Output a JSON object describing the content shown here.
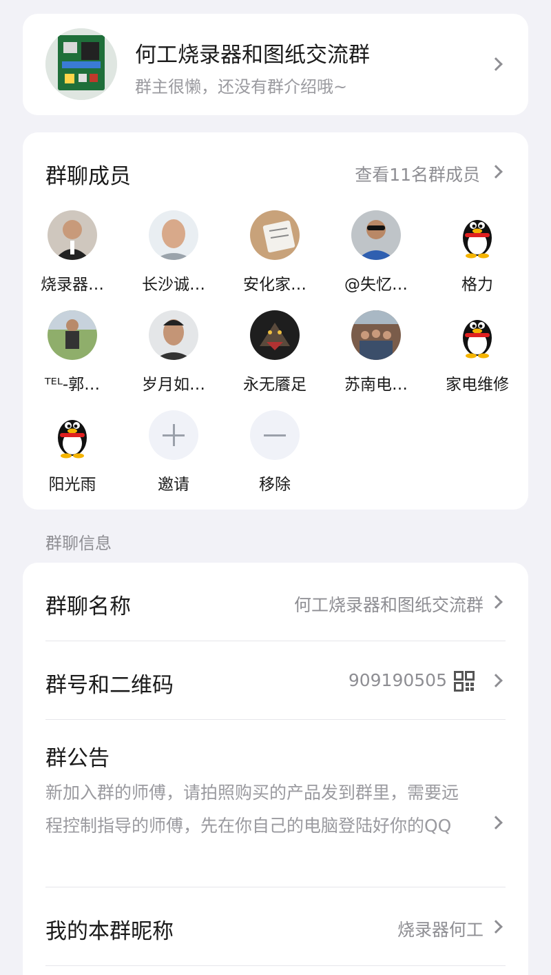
{
  "header": {
    "group_name": "何工烧录器和图纸交流群",
    "description": "群主很懒，还没有群介绍哦~"
  },
  "members": {
    "section_title": "群聊成员",
    "view_all_label": "查看11名群成员",
    "list": [
      {
        "name": "烧录器…",
        "avatar": "photo"
      },
      {
        "name": "长沙诚…",
        "avatar": "photo"
      },
      {
        "name": "安化家…",
        "avatar": "photo"
      },
      {
        "name": "@失忆…",
        "avatar": "photo"
      },
      {
        "name": "格力",
        "avatar": "qq-penguin-icon"
      },
      {
        "name": "ᵀᴱᴸ-郭…",
        "avatar": "photo"
      },
      {
        "name": "岁月如…",
        "avatar": "photo"
      },
      {
        "name": "永无餍足",
        "avatar": "photo"
      },
      {
        "name": "苏南电…",
        "avatar": "photo"
      },
      {
        "name": "家电维修",
        "avatar": "qq-penguin-icon"
      },
      {
        "name": "阳光雨",
        "avatar": "qq-penguin-icon"
      }
    ],
    "invite_label": "邀请",
    "remove_label": "移除"
  },
  "info_section_label": "群聊信息",
  "info": {
    "name_row": {
      "title": "群聊名称",
      "value": "何工烧录器和图纸交流群"
    },
    "id_row": {
      "title": "群号和二维码",
      "value": "909190505"
    },
    "notice_row": {
      "title": "群公告",
      "text": "新加入群的师傅，请拍照购买的产品发到群里，需要远程控制指导的师傅，先在你自己的电脑登陆好你的QQ"
    },
    "nickname_row": {
      "title": "我的本群昵称",
      "value": "烧录器何工"
    }
  }
}
